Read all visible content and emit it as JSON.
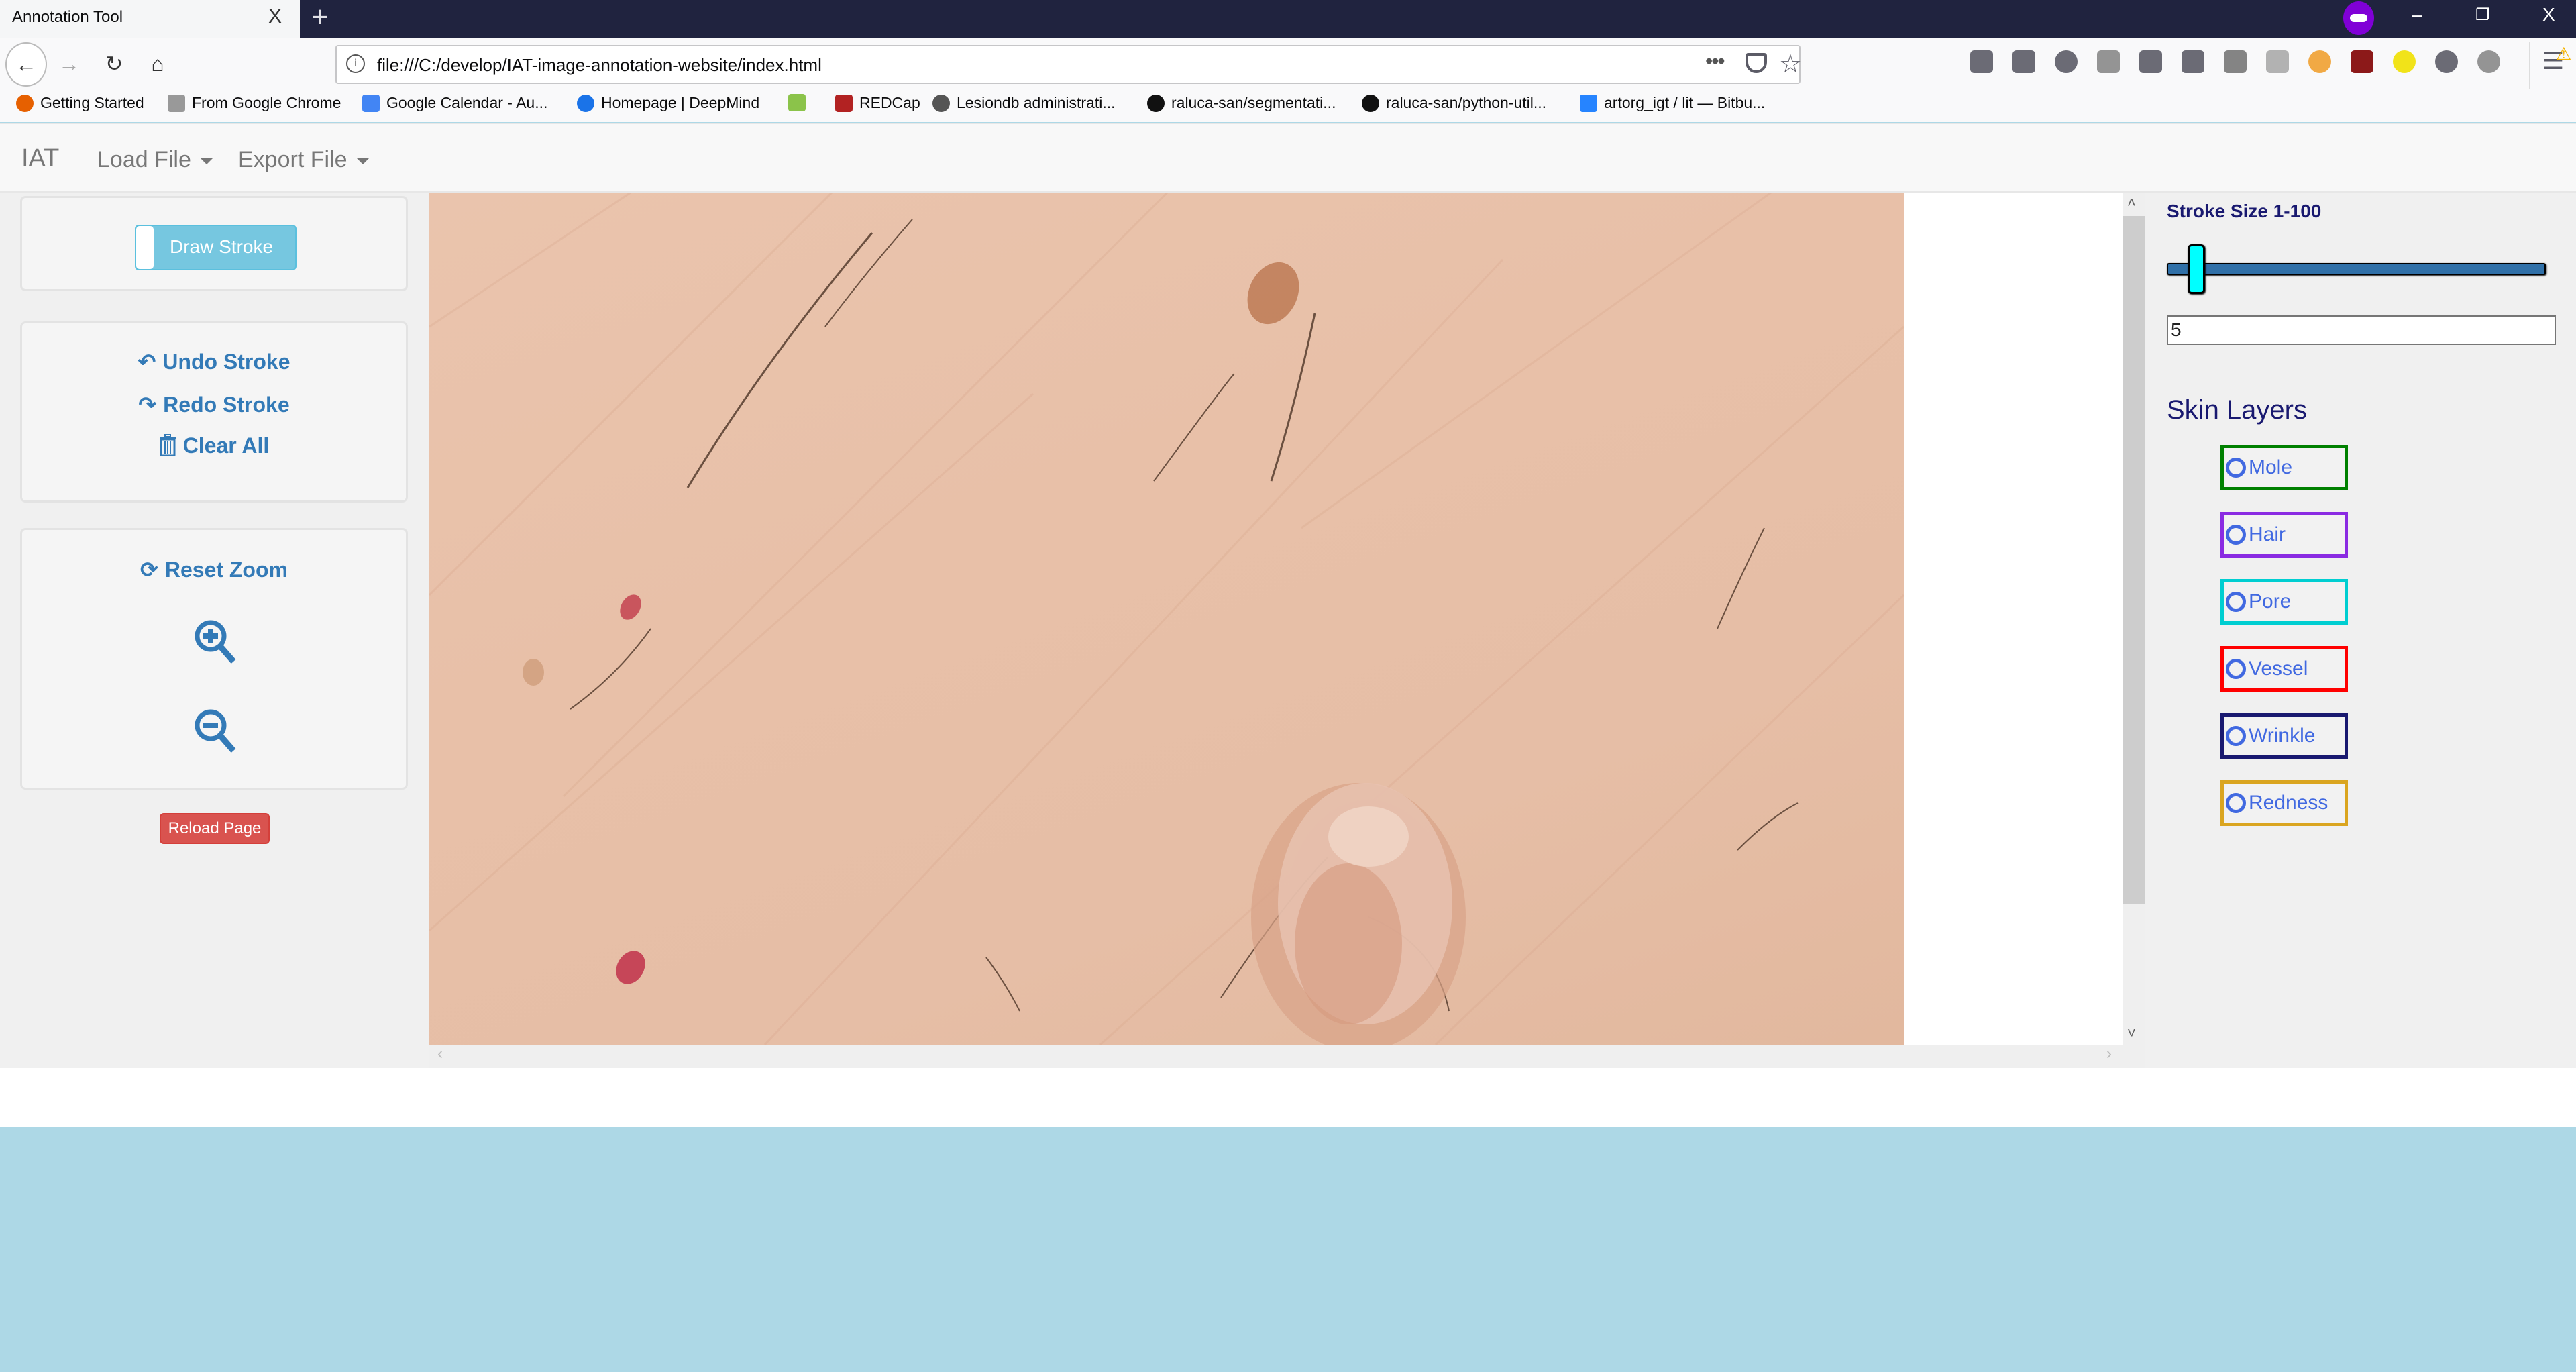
{
  "browser": {
    "tab_title": "Annotation Tool",
    "tab_close": "X",
    "new_tab": "+",
    "url": "file:///C:/develop/IAT-image-annotation-website/index.html",
    "url_more": "•••",
    "window_controls": {
      "minimize": "–",
      "maximize": "❐",
      "close": "X"
    },
    "bookmarks": [
      {
        "label": "Getting Started",
        "icon": "firefox-icon",
        "color": "#e66000"
      },
      {
        "label": "From Google Chrome",
        "icon": "folder-icon",
        "color": "#999999"
      },
      {
        "label": "Google Calendar - Au...",
        "icon": "calendar-icon",
        "color": "#4285f4"
      },
      {
        "label": "Homepage | DeepMind",
        "icon": "deepmind-icon",
        "color": "#1a73e8"
      },
      {
        "label": "",
        "icon": "dots-icon",
        "color": "#8bc34a"
      },
      {
        "label": "REDCap",
        "icon": "redcap-icon",
        "color": "#b22222"
      },
      {
        "label": "Lesiondb administrati...",
        "icon": "globe-icon",
        "color": "#555555"
      },
      {
        "label": "raluca-san/segmentati...",
        "icon": "github-icon",
        "color": "#111111"
      },
      {
        "label": "raluca-san/python-util...",
        "icon": "github-icon",
        "color": "#111111"
      },
      {
        "label": "artorg_igt / lit — Bitbu...",
        "icon": "bitbucket-icon",
        "color": "#2684ff"
      }
    ],
    "toolbar_icons": [
      {
        "name": "library-icon",
        "color": "#5b5b66"
      },
      {
        "name": "sidebar-icon",
        "color": "#5b5b66"
      },
      {
        "name": "history-icon",
        "color": "#5b5b66"
      },
      {
        "name": "shield-lock-icon",
        "color": "#888888"
      },
      {
        "name": "hand-stop-icon",
        "color": "#5b5b66"
      },
      {
        "name": "hat-icon",
        "color": "#5b5b66"
      },
      {
        "name": "bitwarden-icon",
        "color": "#777777"
      },
      {
        "name": "document-icon",
        "color": "#aaaaaa"
      },
      {
        "name": "cplus-icon",
        "color": "#f0a030"
      },
      {
        "name": "ublock-icon",
        "color": "#800000"
      },
      {
        "name": "bulb-icon",
        "color": "#f0e000"
      },
      {
        "name": "account-icon",
        "color": "#5b5b66"
      },
      {
        "name": "pinterest-icon",
        "color": "#888888"
      }
    ]
  },
  "app": {
    "brand": "IAT",
    "menus": [
      {
        "label": "Load File"
      },
      {
        "label": "Export File"
      }
    ]
  },
  "left_panel": {
    "draw_stroke_label": "Draw Stroke",
    "draw_stroke_on": false,
    "undo_label": "Undo Stroke",
    "redo_label": "Redo Stroke",
    "clear_label": "Clear All",
    "reset_zoom_label": "Reset Zoom",
    "reload_label": "Reload Page"
  },
  "canvas": {
    "scroll_left": "‹",
    "scroll_right": "›",
    "scroll_up": "˄",
    "scroll_down": "˅"
  },
  "right_panel": {
    "stroke_label": "Stroke Size 1-100",
    "stroke_min": 1,
    "stroke_max": 100,
    "stroke_value": 5,
    "stroke_input_value": "5",
    "layers_title": "Skin Layers",
    "layers": [
      {
        "label": "Mole",
        "color": "#008000"
      },
      {
        "label": "Hair",
        "color": "#8a2be2"
      },
      {
        "label": "Pore",
        "color": "#00ced1"
      },
      {
        "label": "Vessel",
        "color": "#ff0000"
      },
      {
        "label": "Wrinkle",
        "color": "#191970"
      },
      {
        "label": "Redness",
        "color": "#daa520"
      }
    ]
  },
  "colors": {
    "link": "#337ab7",
    "panel_title": "#191970",
    "radio": "#4169e1",
    "footer": "#add8e6",
    "reload": "#d9534f",
    "toggle": "#76c7e0"
  }
}
